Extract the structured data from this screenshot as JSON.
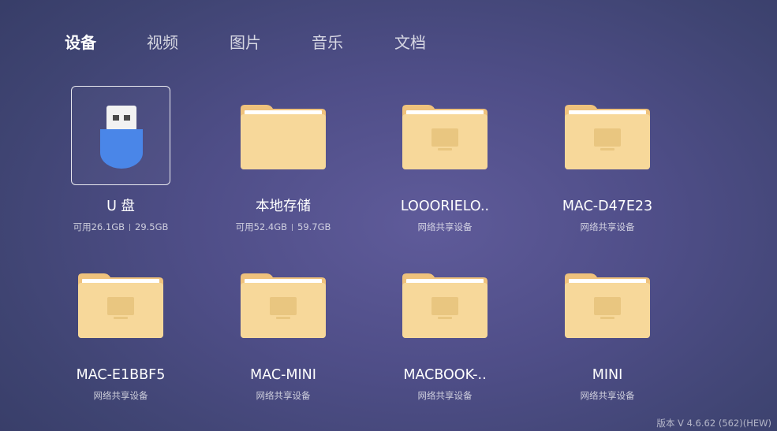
{
  "tabs": [
    {
      "label": "设备",
      "active": true
    },
    {
      "label": "视频",
      "active": false
    },
    {
      "label": "图片",
      "active": false
    },
    {
      "label": "音乐",
      "active": false
    },
    {
      "label": "文档",
      "active": false
    }
  ],
  "items": [
    {
      "icon": "usb-drive-icon",
      "name": "U 盘",
      "available": "可用26.1GB",
      "total": "29.5GB",
      "focused": true
    },
    {
      "icon": "folder-icon",
      "name": "本地存储",
      "available": "可用52.4GB",
      "total": "59.7GB"
    },
    {
      "icon": "network-folder-icon",
      "name": "LOOORIELO..",
      "subtitle": "网络共享设备"
    },
    {
      "icon": "network-folder-icon",
      "name": "MAC-D47E23",
      "subtitle": "网络共享设备"
    },
    {
      "icon": "network-folder-icon",
      "name": "MAC-E1BBF5",
      "subtitle": "网络共享设备"
    },
    {
      "icon": "network-folder-icon",
      "name": "MAC-MINI",
      "subtitle": "网络共享设备"
    },
    {
      "icon": "network-folder-icon",
      "name": "MACBOOK-..",
      "subtitle": "网络共享设备"
    },
    {
      "icon": "network-folder-icon",
      "name": "MINI",
      "subtitle": "网络共享设备"
    }
  ],
  "version": "版本 V 4.6.62 (562)(HEW)",
  "colors": {
    "folder_body": "#f7d89a",
    "folder_tab": "#efc27c",
    "folder_paper": "#ffffff",
    "folder_monitor": "#e9c680",
    "usb_body": "#4a86e8",
    "usb_connector": "#f2f2f2",
    "focus_border": "#ffffff"
  }
}
